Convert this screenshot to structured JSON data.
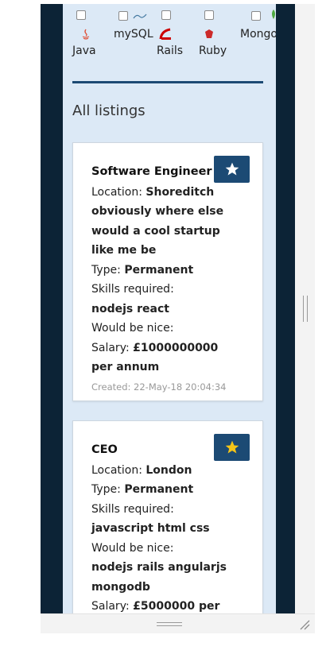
{
  "filters": {
    "techs": [
      {
        "name": "Java",
        "icon": "java-logo-icon"
      },
      {
        "name": "mySQL",
        "icon": "mysql-logo-icon"
      },
      {
        "name": "Rails",
        "icon": "rails-logo-icon"
      },
      {
        "name": "Ruby",
        "icon": "ruby-logo-icon"
      },
      {
        "name": "Mongo",
        "icon": "mongodb-logo-icon"
      }
    ]
  },
  "listings_heading": "All listings",
  "listings": [
    {
      "title": "Software Engineer",
      "location_label": "Location:",
      "location": "Shoreditch obviously where else would a cool startup like me be",
      "type_label": "Type:",
      "type": "Permanent",
      "skills_label": "Skills required:",
      "skills": "nodejs react",
      "nice_label": "Would be nice:",
      "nice": "",
      "salary_label": "Salary:",
      "salary": "£1000000000 per annum",
      "created": "Created: 22-May-18 20:04:34",
      "starred": false
    },
    {
      "title": "CEO",
      "location_label": "Location:",
      "location": "London",
      "type_label": "Type:",
      "type": "Permanent",
      "skills_label": "Skills required:",
      "skills": "javascript html css",
      "nice_label": "Would be nice:",
      "nice": "nodejs rails angularjs mongodb",
      "salary_label": "Salary:",
      "salary": "£5000000 per",
      "starred": true
    }
  ],
  "colors": {
    "dark": "#0c2336",
    "panel": "#dce9f6",
    "button": "#1c4a74",
    "star_on": "#f5c518",
    "star_off": "#ffffff"
  }
}
